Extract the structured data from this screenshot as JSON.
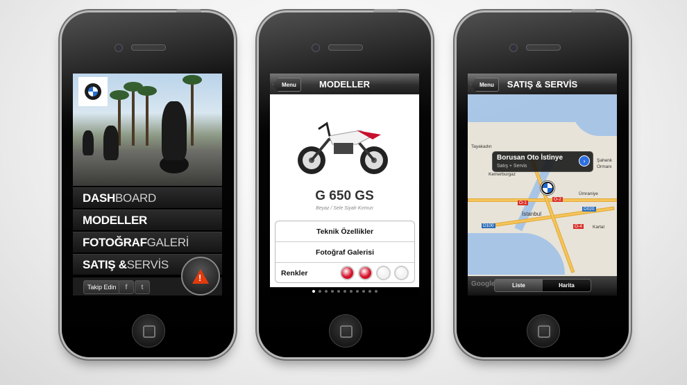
{
  "phones": {
    "dashboard": {
      "menu": [
        {
          "bold": "DASH",
          "light": "BOARD"
        },
        {
          "bold": "MODELLER",
          "light": ""
        },
        {
          "bold": "FOTOĞRAF",
          "light": " GALERİ"
        },
        {
          "bold": "SATIŞ &",
          "light": " SERVİS"
        }
      ],
      "follow_label": "Takip Edin",
      "facebook_glyph": "f",
      "twitter_glyph": "t",
      "warning_glyph": "!"
    },
    "models": {
      "back_label": "Menu",
      "title": "MODELLER",
      "model_name": "G 650 GS",
      "model_subtitle": "Beyaz / Sele Siyah Kırmızı",
      "rows": [
        "Teknik Özellikler",
        "Fotoğraf Galerisi"
      ],
      "colors_label": "Renkler",
      "colors": [
        "#d4112a",
        "#d4112a",
        "#f2f2f2",
        "#f2f2f2"
      ],
      "page_dots": {
        "count": 11,
        "active": 1
      }
    },
    "sales": {
      "back_label": "Menu",
      "title": "SATIŞ & SERVİS",
      "callout_title": "Borusan Oto İstinye",
      "callout_subtitle": "Satış + Servis",
      "map_labels": [
        "Tayakadın",
        "Kemerburgaz",
        "İstanbul",
        "Ümraniye",
        "Kartal",
        "Şahenk",
        "Ormanı"
      ],
      "road_badges": [
        "O-1",
        "O-2",
        "O-4",
        "D100",
        "D020"
      ],
      "segments": [
        "Liste",
        "Harita"
      ],
      "map_brand": "Google",
      "disclosure_glyph": "›"
    }
  },
  "colors": {
    "accent_blue": "#1c69d4",
    "bmw_red": "#d4112a",
    "warning_orange": "#e53a0c"
  }
}
